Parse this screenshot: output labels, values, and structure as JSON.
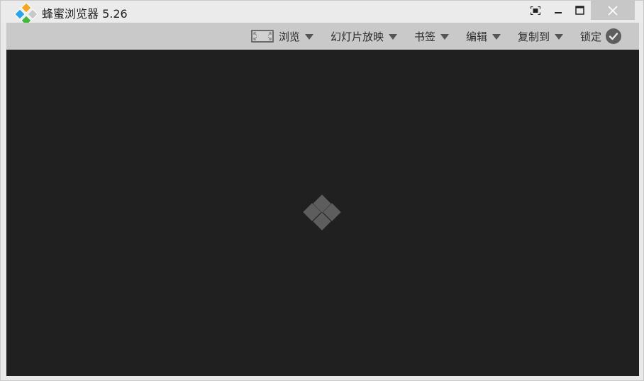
{
  "window": {
    "title": "蜂蜜浏览器 5.26",
    "icons": {
      "logo": "app-logo-icon",
      "fullscreen": "fullscreen-icon",
      "minimize": "minimize-icon",
      "maximize": "maximize-icon",
      "close": "close-icon"
    }
  },
  "toolbar": {
    "browse_label": "浏览",
    "slideshow_label": "幻灯片放映",
    "bookmark_label": "书签",
    "edit_label": "编辑",
    "copyto_label": "复制到",
    "lock_label": "锁定"
  },
  "viewer": {
    "placeholder_icon": "empty-image-placeholder-icon"
  },
  "colors": {
    "titlebar_bg": "#ebebeb",
    "toolbar_bg": "#c9c9c9",
    "viewer_bg": "#202020",
    "close_btn_bg": "#c7c7c7",
    "logo_orange": "#f5a623",
    "logo_blue": "#2aa3e8",
    "logo_green": "#47b83f"
  }
}
